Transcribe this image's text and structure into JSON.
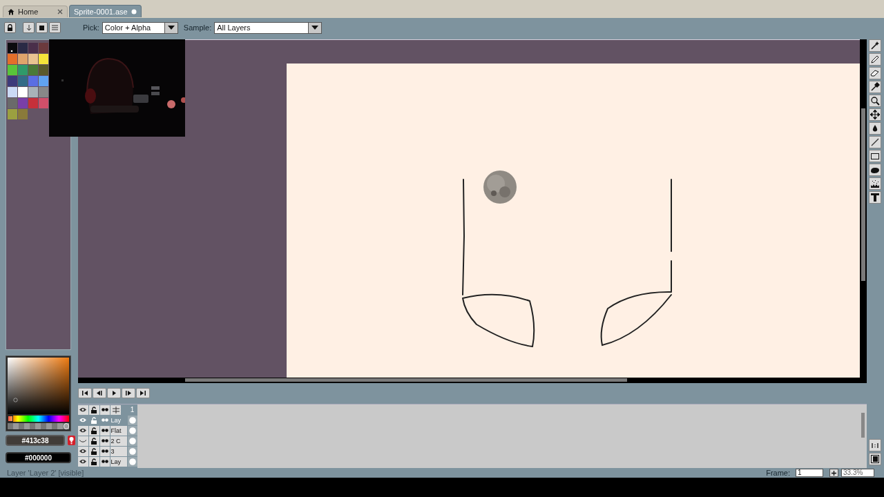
{
  "tabs": [
    {
      "label": "Home",
      "selected": false,
      "kind": "home"
    },
    {
      "label": "Sprite-0001.ase",
      "selected": true,
      "kind": "document"
    }
  ],
  "toolbar": {
    "pick_label": "Pick:",
    "pick_value": "Color + Alpha",
    "sample_label": "Sample:",
    "sample_value": "All Layers"
  },
  "palette": [
    {
      "color": "#0b0b0e",
      "selected": true
    },
    {
      "color": "#2a2a45",
      "selected": false
    },
    {
      "color": "#4a2f4a",
      "selected": false
    },
    {
      "color": "#6b3a3d",
      "selected": false
    },
    {
      "color": "#e36f2a",
      "selected": false
    },
    {
      "color": "#dfa46b",
      "selected": false
    },
    {
      "color": "#e9c390",
      "selected": false
    },
    {
      "color": "#f5e33a",
      "selected": false
    },
    {
      "color": "#58c53a",
      "selected": false
    },
    {
      "color": "#2f9a6a",
      "selected": false
    },
    {
      "color": "#4a7a37",
      "selected": false
    },
    {
      "color": "#5b5a2c",
      "selected": false
    },
    {
      "color": "#3d3a7a",
      "selected": false
    },
    {
      "color": "#336b87",
      "selected": false
    },
    {
      "color": "#5a6ee3",
      "selected": false
    },
    {
      "color": "#61a3f0",
      "selected": false
    },
    {
      "color": "#cbdaf5",
      "selected": false
    },
    {
      "color": "#ffffff",
      "selected": false
    },
    {
      "color": "#a8b2b8",
      "selected": false
    },
    {
      "color": "#888888",
      "selected": false
    },
    {
      "color": "#6a6a6a",
      "selected": false
    },
    {
      "color": "#7a3fa8",
      "selected": false
    },
    {
      "color": "#c6303a",
      "selected": false
    },
    {
      "color": "#d04f6a",
      "selected": false
    },
    {
      "color": "#9ba040",
      "selected": false
    },
    {
      "color": "#8a7a3a",
      "selected": false
    }
  ],
  "color_picker": {
    "hue": {
      "level": 0.04
    },
    "alpha": {
      "level": 1
    }
  },
  "colors": {
    "foreground": "#413c38",
    "background": "#000000"
  },
  "timeline": {
    "frame_header": "1",
    "layers": [
      {
        "name": "Lay",
        "visible": true,
        "selected": true
      },
      {
        "name": "Flat",
        "visible": true,
        "selected": false
      },
      {
        "name": "2 C",
        "visible": false,
        "selected": false
      },
      {
        "name": "3",
        "visible": true,
        "selected": false
      },
      {
        "name": "Lay",
        "visible": true,
        "selected": false
      }
    ]
  },
  "status_bar": {
    "message": "Layer 'Layer 2' [visible]",
    "frame_label": "Frame:",
    "frame": "1",
    "zoom": "33.3%"
  }
}
